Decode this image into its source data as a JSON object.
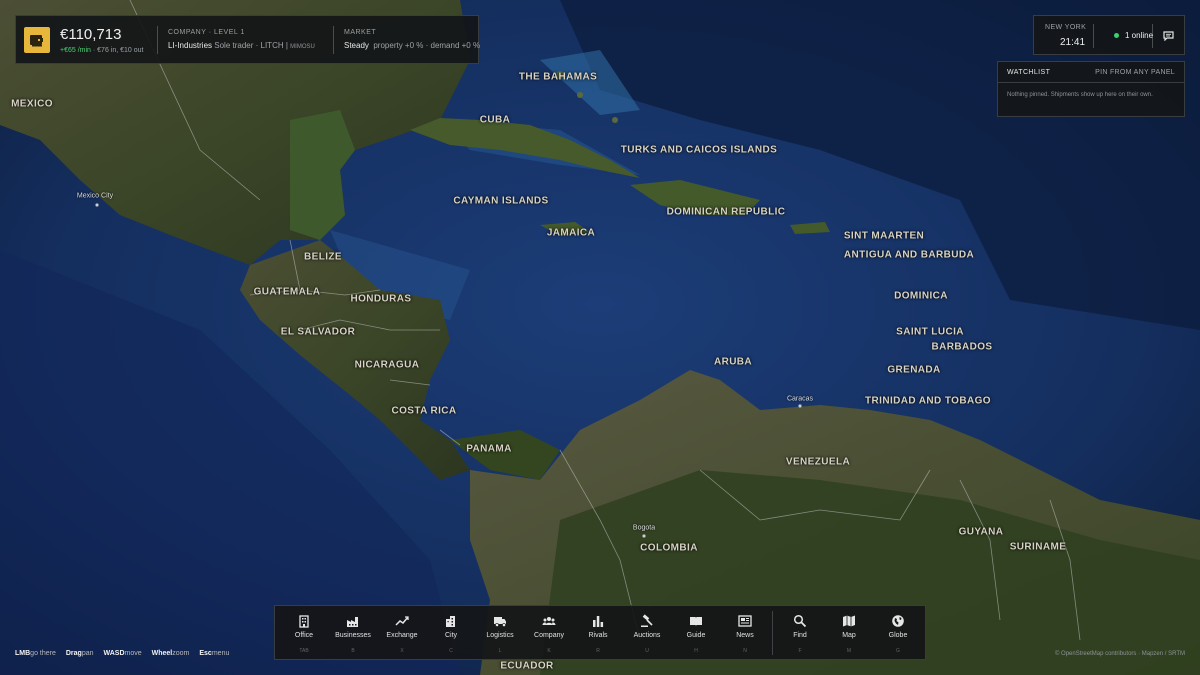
{
  "hud": {
    "balance": "€110,713",
    "income_rate": "+€65 /min",
    "income_detail": " · €76 in, €10 out",
    "company_heading": "COMPANY · LEVEL 1",
    "company_name": "LI-Industries",
    "company_type": "Sole trader · LITCH",
    "company_tag": "MIMOSU",
    "market_heading": "MARKET",
    "market_state": "Steady",
    "market_detail": "property +0 % · demand +0 %"
  },
  "clock": {
    "city": "NEW YORK",
    "time": "21:41",
    "online": "1 online"
  },
  "watchlist": {
    "title": "WATCHLIST",
    "pin_hint": "PIN FROM ANY PANEL",
    "empty_text": "Nothing pinned. Shipments show up here on their own."
  },
  "map": {
    "countries": [
      "MEXICO",
      "THE BAHAMAS",
      "CUBA",
      "TURKS AND CAICOS ISLANDS",
      "CAYMAN ISLANDS",
      "DOMINICAN REPUBLIC",
      "JAMAICA",
      "SINT MAARTEN",
      "ANTIGUA AND BARBUDA",
      "BELIZE",
      "GUATEMALA",
      "HONDURAS",
      "DOMINICA",
      "EL SALVADOR",
      "SAINT LUCIA",
      "BARBADOS",
      "NICARAGUA",
      "ARUBA",
      "GRENADA",
      "COSTA RICA",
      "TRINIDAD AND TOBAGO",
      "PANAMA",
      "VENEZUELA",
      "GUYANA",
      "COLOMBIA",
      "SURINAME",
      "ECUADOR"
    ],
    "cities": [
      "Mexico City",
      "Caracas",
      "Bogota"
    ]
  },
  "toolbar": [
    {
      "label": "Office",
      "key": "TAB",
      "icon": "office-icon"
    },
    {
      "label": "Businesses",
      "key": "B",
      "icon": "factory-icon"
    },
    {
      "label": "Exchange",
      "key": "X",
      "icon": "trend-icon"
    },
    {
      "label": "City",
      "key": "C",
      "icon": "city-icon"
    },
    {
      "label": "Logistics",
      "key": "L",
      "icon": "truck-icon"
    },
    {
      "label": "Company",
      "key": "K",
      "icon": "people-icon"
    },
    {
      "label": "Rivals",
      "key": "R",
      "icon": "bars-icon"
    },
    {
      "label": "Auctions",
      "key": "U",
      "icon": "gavel-icon"
    },
    {
      "label": "Guide",
      "key": "H",
      "icon": "book-icon"
    },
    {
      "label": "News",
      "key": "N",
      "icon": "news-icon"
    },
    {
      "label": "Find",
      "key": "F",
      "icon": "search-icon"
    },
    {
      "label": "Map",
      "key": "M",
      "icon": "map-icon"
    },
    {
      "label": "Globe",
      "key": "G",
      "icon": "globe-icon"
    }
  ],
  "hints": [
    {
      "key": "LMB",
      "action": "go there"
    },
    {
      "key": "Drag",
      "action": "pan"
    },
    {
      "key": "WASD",
      "action": "move"
    },
    {
      "key": "Wheel",
      "action": "zoom"
    },
    {
      "key": "Esc",
      "action": "menu"
    }
  ],
  "attribution": "© OpenStreetMap contributors · Mapzen / SRTM",
  "colors": {
    "accent": "#e7b73c",
    "positive": "#4ad174",
    "online": "#3ad36b"
  }
}
